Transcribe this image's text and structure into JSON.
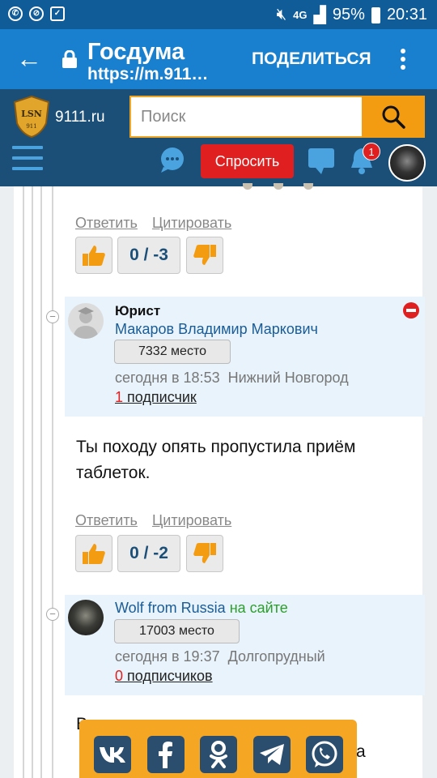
{
  "status": {
    "network": "4G",
    "battery": "95%",
    "time": "20:31"
  },
  "browser": {
    "title": "Госдума",
    "url": "https://m.911…",
    "share_label": "ПОДЕЛИТЬСЯ"
  },
  "site": {
    "logo_badge": "LSN",
    "logo_badge_sub": "911",
    "logo_text": "9111.ru",
    "search_placeholder": "Поиск",
    "ask_label": "Спросить",
    "notifications_count": "1"
  },
  "colors": {
    "status_bar": "#0f5c99",
    "browser_bar": "#1880cf",
    "site_header": "#1b4f78",
    "accent_orange": "#f39c12",
    "ask_red": "#e02020",
    "author_bg": "#e8f3fb"
  },
  "actions": {
    "reply": "Ответить",
    "quote": "Цитировать"
  },
  "comments": [
    {
      "score": "0 / -3"
    },
    {
      "role": "Юрист",
      "author": "Макаров Владимир Маркович",
      "rank": "7332 место",
      "time": "сегодня в 18:53",
      "city": "Нижний Новгород",
      "subscribers_count": "1",
      "subscribers_label": "подписчик",
      "text": "Ты походу опять пропустила приём таблеток.",
      "score": "0 / -2"
    },
    {
      "author": "Wolf from Russia",
      "status": "на сайте",
      "rank": "17003 место",
      "time": "сегодня в 19:37",
      "city": "Долгопрудный",
      "subscribers_count": "0",
      "subscribers_label": "подписчиков",
      "text_fragment": "В",
      "text_fragment_2": "a"
    }
  ],
  "share_panel": {
    "vk": "vk-icon",
    "facebook": "facebook-icon",
    "ok": "odnoklassniki-icon",
    "telegram": "telegram-icon",
    "whatsapp": "whatsapp-icon"
  }
}
